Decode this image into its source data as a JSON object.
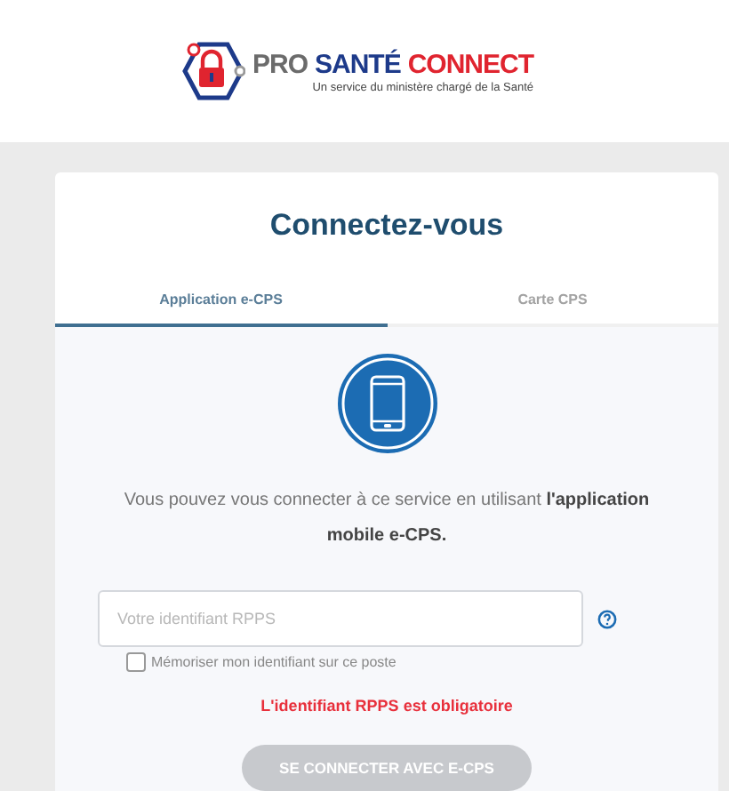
{
  "logo": {
    "parts": [
      {
        "text": "PRO",
        "kind": "grey"
      },
      {
        "text": "SANTÉ",
        "kind": "blue"
      },
      {
        "text": "CONNECT",
        "kind": "red"
      }
    ],
    "tagline": "Un service du ministère chargé de la Santé"
  },
  "title": "Connectez-vous",
  "tabs": [
    {
      "label": "Application e-CPS",
      "selected": true
    },
    {
      "label": "Carte CPS",
      "selected": false
    }
  ],
  "intro": "Vous pouvez vous connecter à ce service en utilisant **l'application mobile e-CPS.**",
  "id_field": {
    "placeholder": "Votre identifiant RPPS"
  },
  "remember": {
    "label": "Mémoriser mon identifiant sur ce poste",
    "checked": false
  },
  "error": "L'identifiant RPPS est obligatoire",
  "submit": {
    "label": "SE CONNECTER AVEC E-CPS",
    "disabled": true
  }
}
